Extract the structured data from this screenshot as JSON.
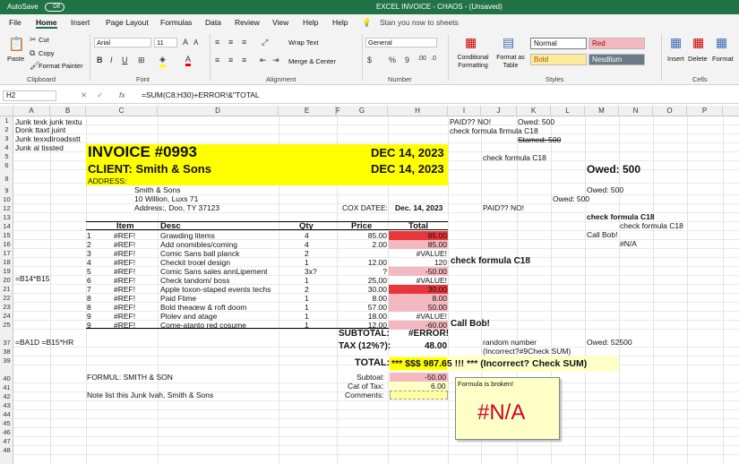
{
  "title_bar": {
    "autosave": "AutoSave",
    "autosave_state": "Off",
    "title": "EXCEL INVOICE - CHAOS - (Unsaved)"
  },
  "tabs": [
    "File",
    "Home",
    "Insert",
    "Page Layout",
    "Formulas",
    "Data",
    "Review",
    "View",
    "Help",
    "Help"
  ],
  "tell_me": "Stan you nsw to sheets",
  "ribbon": {
    "paste": "Paste",
    "cut": "Cut",
    "copy": "Copy",
    "format_painter": "Format Painter",
    "clipboard": "Clipboard",
    "font_name": "Arial",
    "font_size": "11",
    "font_group": "Font",
    "wrap_text": "Wrap Text",
    "merge_center": "Merge & Center",
    "alignment_group": "Alignment",
    "number_format": "General",
    "number_group": "Number",
    "conditional_formatting": "Conditional Formatting",
    "format_as_table": "Format as Table",
    "styles": {
      "normal": "Normal",
      "bad": "Red",
      "good": "Bold",
      "neutral": "Nesdlium"
    },
    "styles_group": "Styles",
    "insert": "Insert",
    "delete": "Delete",
    "format": "Format",
    "cells_group": "Cells"
  },
  "formula_bar": {
    "name_box": "H2",
    "fx": "fx",
    "formula": "=SUM(C8:H30)+ERROR!&\"TOTAL"
  },
  "columns": [
    "A",
    "B",
    "C",
    "D",
    "E",
    "F",
    "G",
    "H",
    "I",
    "J",
    "K",
    "L",
    "M",
    "N",
    "O",
    "P"
  ],
  "rows": [
    "1",
    "2",
    "3",
    "4",
    "5",
    "6",
    "8",
    "9",
    "10",
    "12",
    "13",
    "14",
    "15",
    "16",
    "17",
    "18",
    "19",
    "20",
    "21",
    "22",
    "23",
    "24",
    "25",
    "37",
    "38",
    "39",
    "40",
    "41",
    "42",
    "43",
    "44",
    "45",
    "46",
    "47",
    "48"
  ],
  "notes": {
    "a1": "Junk texk junk textu",
    "a2": "Donk ttaxt juint",
    "a3": "Junk texxdiroadsstt",
    "a4": "Junk al tissted",
    "a20": "=B14*B15",
    "a37": "=BA1D =B15*HR"
  },
  "right": {
    "paid_no": "PAID?? NO!",
    "owed_500_a": "Owed: 500",
    "check_c18_a": "check formula firmula C18",
    "stamed": "Stamed: 500",
    "check_c18_b": "check formula C18",
    "owed_500_big": "Owed: 500",
    "owed_500_b": "Owed: 500",
    "owed_500_c": "Owed: 500",
    "paid_no_b": "PAID?? NO!",
    "check_c18_c": "check formula C18",
    "check_c18_d": "check formula C18",
    "call_bob": "Call Bob!",
    "na": "#N/A",
    "check_c18_bold": "check formula C18",
    "call_bob_bold": "Call Bob!",
    "random": "random number",
    "owed_52500": "Owed: 52500",
    "incorrect": "(Incorrect?#9Check SUM)"
  },
  "invoice": {
    "title": "INVOICE #0993",
    "date": "DEC 14, 2023",
    "client": "CLIENT: Smith & Sons",
    "date2": "DEC 14, 2023",
    "address_label": "ADDRESS:",
    "addr1": "Smith & Sons",
    "addr2": "10 Willion, Luxs 71",
    "addr3": "Address:, Doo, TY 37123",
    "co_date_label": "COX DATEE:",
    "co_date": "Dec. 14, 2023",
    "headers": {
      "item": "Item",
      "desc": "Desc",
      "qty": "Qty",
      "price": "Price",
      "total": "Total"
    },
    "items": [
      {
        "n": "1",
        "item": "#REF!",
        "desc": "Grawding litems",
        "qty": "4",
        "price": "85.00",
        "total": "85.00"
      },
      {
        "n": "2",
        "item": "#REF!",
        "desc": "Add onomibles/coming",
        "qty": "4",
        "price": "2.00",
        "total": "85.00"
      },
      {
        "n": "3",
        "item": "#REF!",
        "desc": "Comic Sans ball planck",
        "qty": "2",
        "price": "",
        "total": "#VALUE!"
      },
      {
        "n": "4",
        "item": "#REF!",
        "desc": "Checkit troœl design",
        "qty": "1",
        "price": "12.00",
        "total": "120"
      },
      {
        "n": "5",
        "item": "#REF!",
        "desc": "Comic Sans sales annLipement",
        "qty": "3x?",
        "price": "?",
        "total": "-50.00"
      },
      {
        "n": "6",
        "item": "#REF!",
        "desc": "Check tandom/ boss",
        "qty": "1",
        "price": "25,00",
        "total": "#VALUE!"
      },
      {
        "n": "7",
        "item": "#REF!",
        "desc": "Apple toxon-staped events techs",
        "qty": "2",
        "price": "30.00",
        "total": "30.00"
      },
      {
        "n": "8",
        "item": "#REF!",
        "desc": "Paid Flime",
        "qty": "1",
        "price": "8.00",
        "total": "8.00"
      },
      {
        "n": "8",
        "item": "#REF!",
        "desc": "Bold theaœw & roft doom",
        "qty": "1",
        "price": "57.00",
        "total": "50.00"
      },
      {
        "n": "9",
        "item": "#REF!",
        "desc": "Plolev and atage",
        "qty": "1",
        "price": "18.00",
        "total": "#VALUE!"
      },
      {
        "n": "9",
        "item": "#REF!",
        "desc": "Come-atanto red cosume",
        "qty": "1",
        "price": "12.00",
        "total": "-60.00"
      }
    ],
    "subtotal_label": "SUBTOTAL:",
    "subtotal": "#ERROR!",
    "tax_label": "TAX (12%?):",
    "tax": "48.00",
    "total_label": "TOTAL:",
    "total": "*** $$$ 987.65 !!! *** (Incorrect? Check SUM)",
    "formul": "FORMUL: SMITH & SON",
    "subtotal2_label": "Subtoal:",
    "subtotal2": "-50.00",
    "cat_tax_label": "Cat of Tax:",
    "cat_tax": "6.00",
    "note": "Note list this Junk Ivah, Smith & Sons",
    "comments_label": "Comments:"
  },
  "comment_box": {
    "text": "Formula is broken!",
    "value": "#N/A"
  },
  "colors": {
    "excel_green": "#217346",
    "invoice_yellow": "#ffff00",
    "red_cell": "#e8373b",
    "pink_cell": "#f4b8c0",
    "pale_yellow": "#ffffc8"
  }
}
